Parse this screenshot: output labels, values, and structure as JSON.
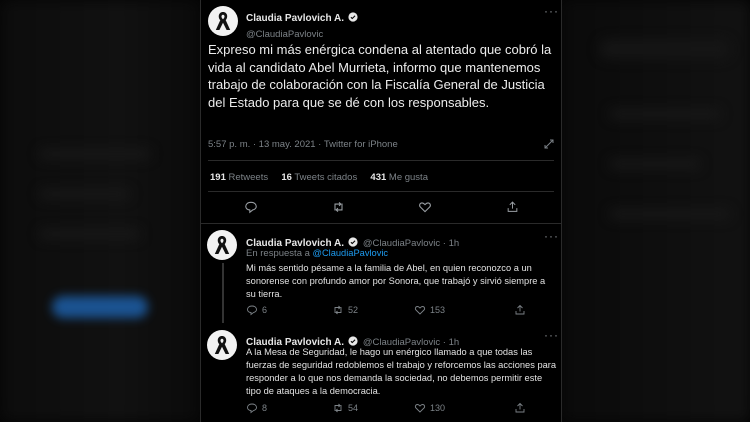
{
  "main_tweet": {
    "name": "Claudia Pavlovich A.",
    "handle": "@ClaudiaPavlovic",
    "text": "Expreso mi más enérgica condena al atentado que cobró la vida al candidato Abel Murrieta, informo que mantenemos trabajo de colaboración con la Fiscalía General de Justicia del Estado para que se dé con los responsables.",
    "meta": "5:57 p. m. · 13 may. 2021 · Twitter for iPhone",
    "retweets_count": "191",
    "retweets_label": "Retweets",
    "quotes_count": "16",
    "quotes_label": "Tweets citados",
    "likes_count": "431",
    "likes_label": "Me gusta"
  },
  "replies": [
    {
      "name": "Claudia Pavlovich A.",
      "handle_time": "@ClaudiaPavlovic · 1h",
      "replying_prefix": "En respuesta a",
      "replying_to": "@ClaudiaPavlovic",
      "text": "Mi más sentido pésame a la familia de Abel, en quien reconozco a un sonorense con profundo amor por Sonora, que trabajó y sirvió siempre a su tierra.",
      "replies_count": "6",
      "retweets_count": "52",
      "likes_count": "153"
    },
    {
      "name": "Claudia Pavlovich A.",
      "handle_time": "@ClaudiaPavlovic · 1h",
      "text": "A la Mesa de Seguridad, le hago un enérgico llamado a que todas las fuerzas de seguridad redoblemos el trabajo y reforcemos las acciones para responder a lo que nos demanda la sociedad, no debemos permitir este tipo de ataques a la democracia.",
      "replies_count": "8",
      "retweets_count": "54",
      "likes_count": "130"
    }
  ],
  "colors": {
    "accent": "#1d9bf0",
    "background": "#000000",
    "muted": "#7c8287"
  },
  "icons": [
    "verified-icon",
    "more-icon",
    "reply-icon",
    "retweet-icon",
    "like-icon",
    "share-icon",
    "analytics-icon",
    "mourning-ribbon-icon"
  ]
}
